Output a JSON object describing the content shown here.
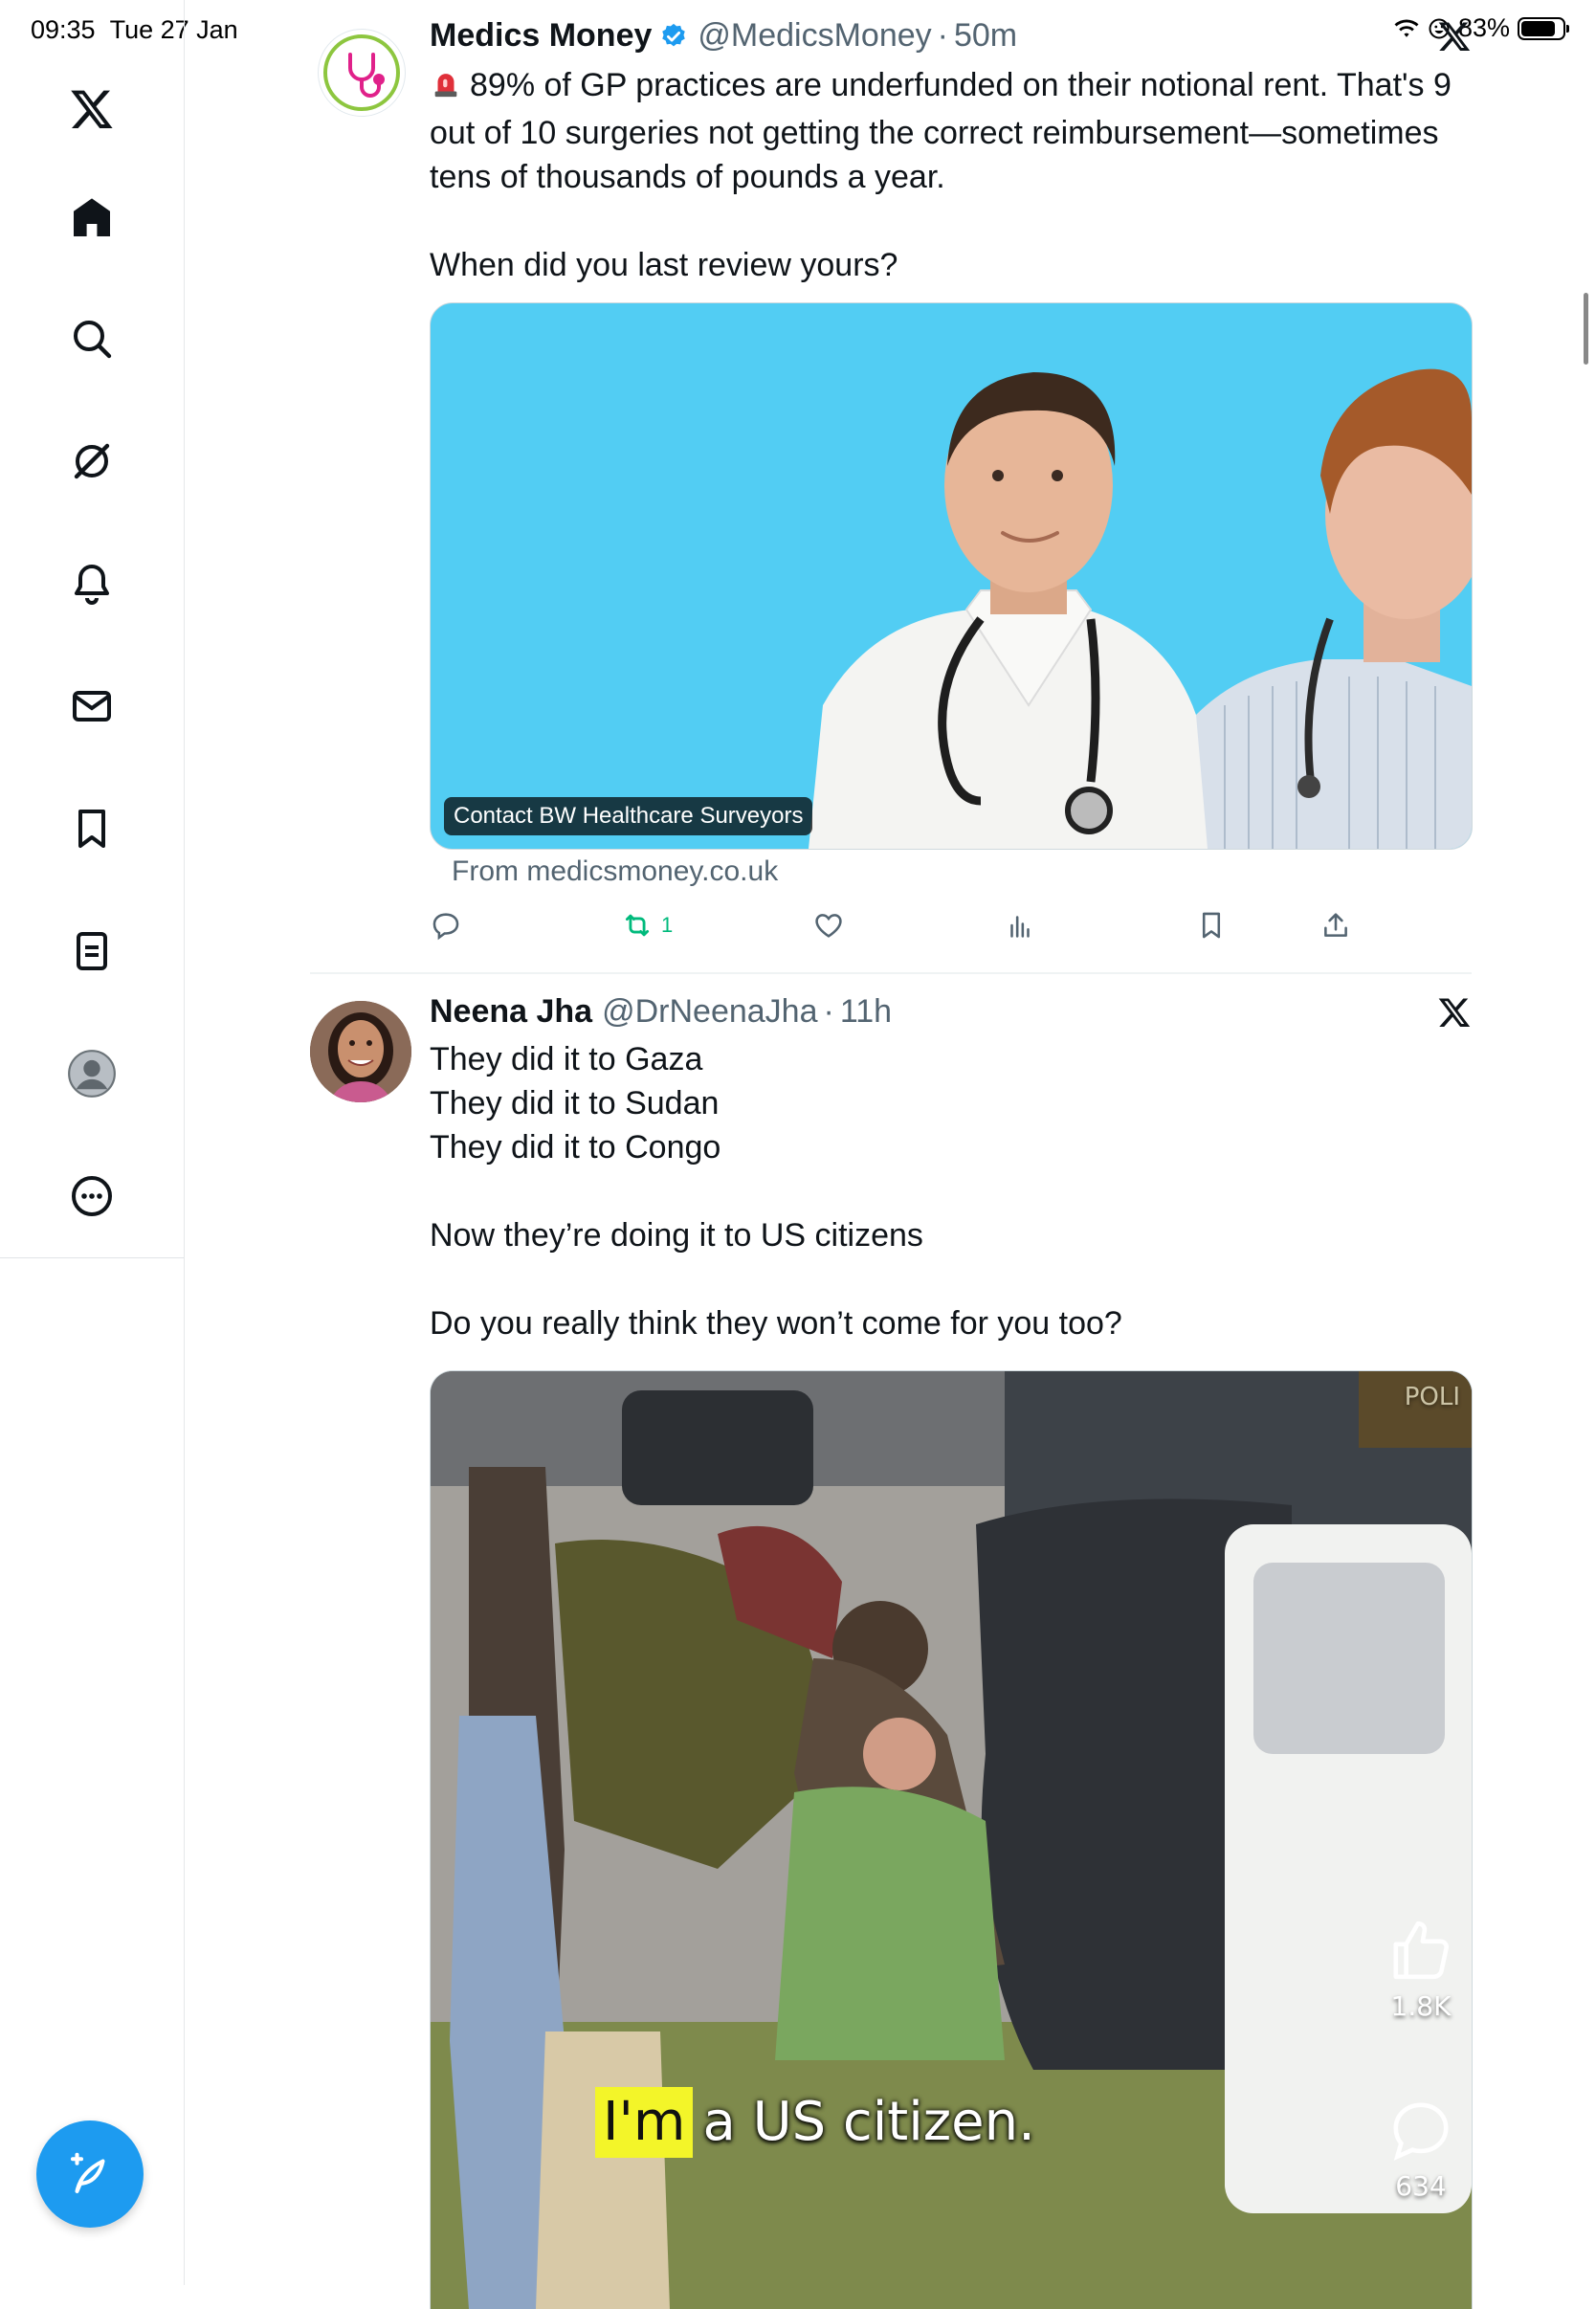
{
  "status_bar": {
    "time": "09:35",
    "date": "Tue 27 Jan",
    "battery": "83%",
    "battery_level": 0.83
  },
  "sidebar": {
    "items": [
      {
        "icon": "x-logo-icon"
      },
      {
        "icon": "home-icon"
      },
      {
        "icon": "search-icon"
      },
      {
        "icon": "grok-icon"
      },
      {
        "icon": "bell-icon"
      },
      {
        "icon": "mail-icon"
      },
      {
        "icon": "bookmark-icon"
      },
      {
        "icon": "lists-icon"
      },
      {
        "icon": "profile-icon"
      },
      {
        "icon": "more-icon"
      }
    ],
    "compose_icon": "compose-feather-icon",
    "accent": "#1d9bf0"
  },
  "tweets": [
    {
      "name": "Medics Money",
      "handle": "@MedicsMoney",
      "separator": "·",
      "time": "50m",
      "verified": true,
      "lines": [
        "89% of GP practices are underfunded on their notional rent. That's 9",
        "out of 10 surgeries not getting the correct reimbursement—sometimes",
        "tens of thousands of pounds a year.",
        "When did you last review yours?"
      ],
      "media_link_label": "Contact BW Healthcare Surveyors",
      "from_label": "From medicsmoney.co.uk",
      "retweet_count": "1",
      "media_background": "#52cdf3"
    },
    {
      "name": "Neena Jha",
      "handle": "@DrNeenaJha",
      "separator": "·",
      "time": "11h",
      "lines": [
        "They did it to Gaza",
        "They did it to Sudan",
        "They did it to Congo",
        "Now they’re doing it to US citizens",
        "Do you really think they won’t come for you too?"
      ],
      "video_caption_highlight": "I'm",
      "video_caption_rest": "a US citizen.",
      "video_sign_text": "POLI",
      "video_likes": "1.8K",
      "video_comments": "634"
    }
  ]
}
